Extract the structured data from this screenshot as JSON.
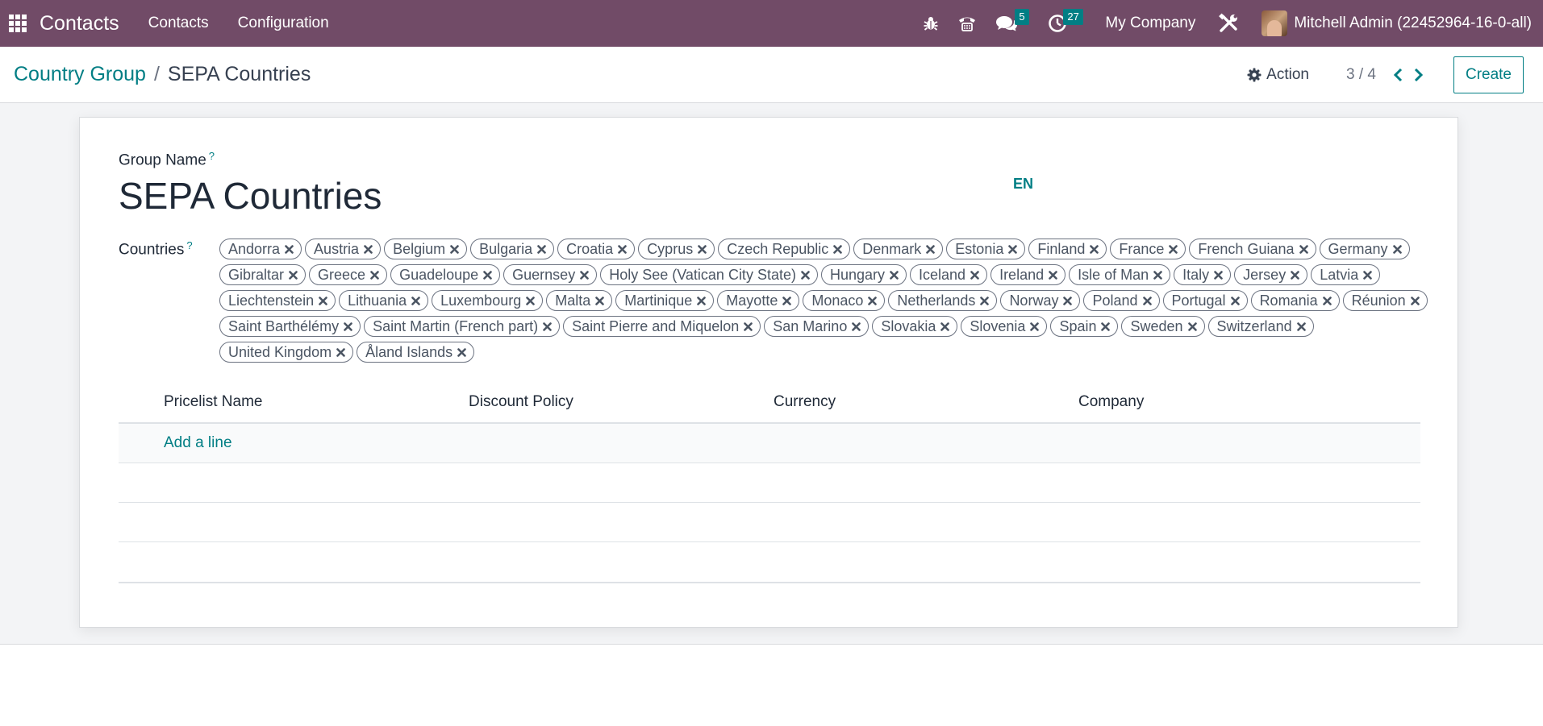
{
  "navbar": {
    "app_name": "Contacts",
    "menus": [
      "Contacts",
      "Configuration"
    ],
    "messages_count": "5",
    "activities_count": "27",
    "company": "My Company",
    "user": "Mitchell Admin (22452964-16-0-all)"
  },
  "breadcrumb": {
    "parent": "Country Group",
    "separator": "/",
    "current": "SEPA Countries"
  },
  "control": {
    "action_label": "Action",
    "pager": "3 / 4",
    "create_label": "Create"
  },
  "form": {
    "group_name_label": "Group Name",
    "help_mark": "?",
    "group_name_value": "SEPA Countries",
    "language": "EN",
    "countries_label": "Countries",
    "countries": [
      "Andorra",
      "Austria",
      "Belgium",
      "Bulgaria",
      "Croatia",
      "Cyprus",
      "Czech Republic",
      "Denmark",
      "Estonia",
      "Finland",
      "France",
      "French Guiana",
      "Germany",
      "Gibraltar",
      "Greece",
      "Guadeloupe",
      "Guernsey",
      "Holy See (Vatican City State)",
      "Hungary",
      "Iceland",
      "Ireland",
      "Isle of Man",
      "Italy",
      "Jersey",
      "Latvia",
      "Liechtenstein",
      "Lithuania",
      "Luxembourg",
      "Malta",
      "Martinique",
      "Mayotte",
      "Monaco",
      "Netherlands",
      "Norway",
      "Poland",
      "Portugal",
      "Romania",
      "Réunion",
      "Saint Barthélémy",
      "Saint Martin (French part)",
      "Saint Pierre and Miquelon",
      "San Marino",
      "Slovakia",
      "Slovenia",
      "Spain",
      "Sweden",
      "Switzerland",
      "United Kingdom",
      "Åland Islands"
    ]
  },
  "table": {
    "columns": [
      "Pricelist Name",
      "Discount Policy",
      "Currency",
      "Company"
    ],
    "add_line": "Add a line"
  },
  "colors": {
    "navbar": "#714b67",
    "accent": "#017e84"
  },
  "icons": [
    "apps-grid-icon",
    "bug-icon",
    "phone-icon",
    "chat-icon",
    "clock-icon",
    "tools-icon",
    "gear-icon",
    "chevron-left-icon",
    "chevron-right-icon",
    "remove-tag-icon"
  ]
}
